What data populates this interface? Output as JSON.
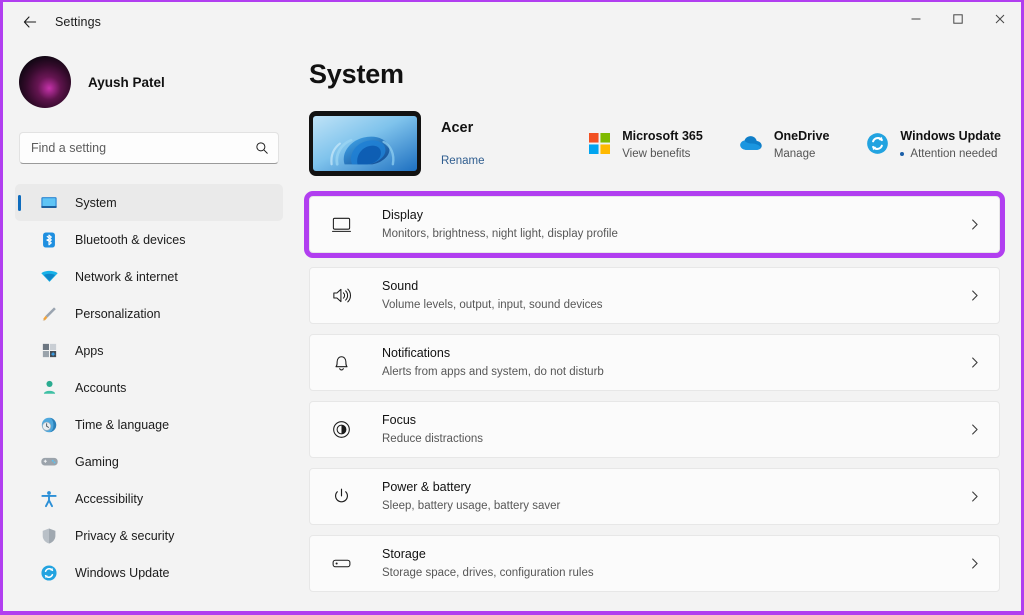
{
  "window": {
    "app_title": "Settings",
    "back_icon": "back-arrow-icon",
    "minimize_label": "Minimize",
    "maximize_label": "Maximize",
    "close_label": "Close",
    "highlight_color": "#b13ef0",
    "accent_color": "#0f6cbd"
  },
  "sidebar": {
    "profile": {
      "name": "Ayush Patel",
      "avatar_icon": "user-avatar"
    },
    "search": {
      "placeholder": "Find a setting",
      "value": "",
      "icon": "search-icon"
    },
    "items": [
      {
        "label": "System",
        "icon": "monitor-icon",
        "selected": true
      },
      {
        "label": "Bluetooth & devices",
        "icon": "bluetooth-icon",
        "selected": false
      },
      {
        "label": "Network & internet",
        "icon": "wifi-icon",
        "selected": false
      },
      {
        "label": "Personalization",
        "icon": "paintbrush-icon",
        "selected": false
      },
      {
        "label": "Apps",
        "icon": "apps-grid-icon",
        "selected": false
      },
      {
        "label": "Accounts",
        "icon": "person-icon",
        "selected": false
      },
      {
        "label": "Time & language",
        "icon": "clock-globe-icon",
        "selected": false
      },
      {
        "label": "Gaming",
        "icon": "gamepad-icon",
        "selected": false
      },
      {
        "label": "Accessibility",
        "icon": "accessibility-icon",
        "selected": false
      },
      {
        "label": "Privacy & security",
        "icon": "shield-icon",
        "selected": false
      },
      {
        "label": "Windows Update",
        "icon": "update-sync-icon",
        "selected": false
      }
    ]
  },
  "main": {
    "title": "System",
    "device": {
      "name": "Acer",
      "rename_label": "Rename",
      "thumbnail_icon": "windows-bloom-wallpaper"
    },
    "services": [
      {
        "title": "Microsoft 365",
        "subtitle": "View benefits",
        "icon": "microsoft-logo-icon",
        "has_dot": false
      },
      {
        "title": "OneDrive",
        "subtitle": "Manage",
        "icon": "onedrive-cloud-icon",
        "has_dot": false
      },
      {
        "title": "Windows Update",
        "subtitle": "Attention needed",
        "icon": "update-sync-icon",
        "has_dot": true
      }
    ],
    "rows": [
      {
        "title": "Display",
        "subtitle": "Monitors, brightness, night light, display profile",
        "icon": "monitor-outline-icon",
        "highlighted": true
      },
      {
        "title": "Sound",
        "subtitle": "Volume levels, output, input, sound devices",
        "icon": "speaker-icon",
        "highlighted": false
      },
      {
        "title": "Notifications",
        "subtitle": "Alerts from apps and system, do not disturb",
        "icon": "bell-icon",
        "highlighted": false
      },
      {
        "title": "Focus",
        "subtitle": "Reduce distractions",
        "icon": "focus-icon",
        "highlighted": false
      },
      {
        "title": "Power & battery",
        "subtitle": "Sleep, battery usage, battery saver",
        "icon": "power-icon",
        "highlighted": false
      },
      {
        "title": "Storage",
        "subtitle": "Storage space, drives, configuration rules",
        "icon": "storage-drive-icon",
        "highlighted": false
      }
    ],
    "chevron_icon": "chevron-right-icon"
  }
}
